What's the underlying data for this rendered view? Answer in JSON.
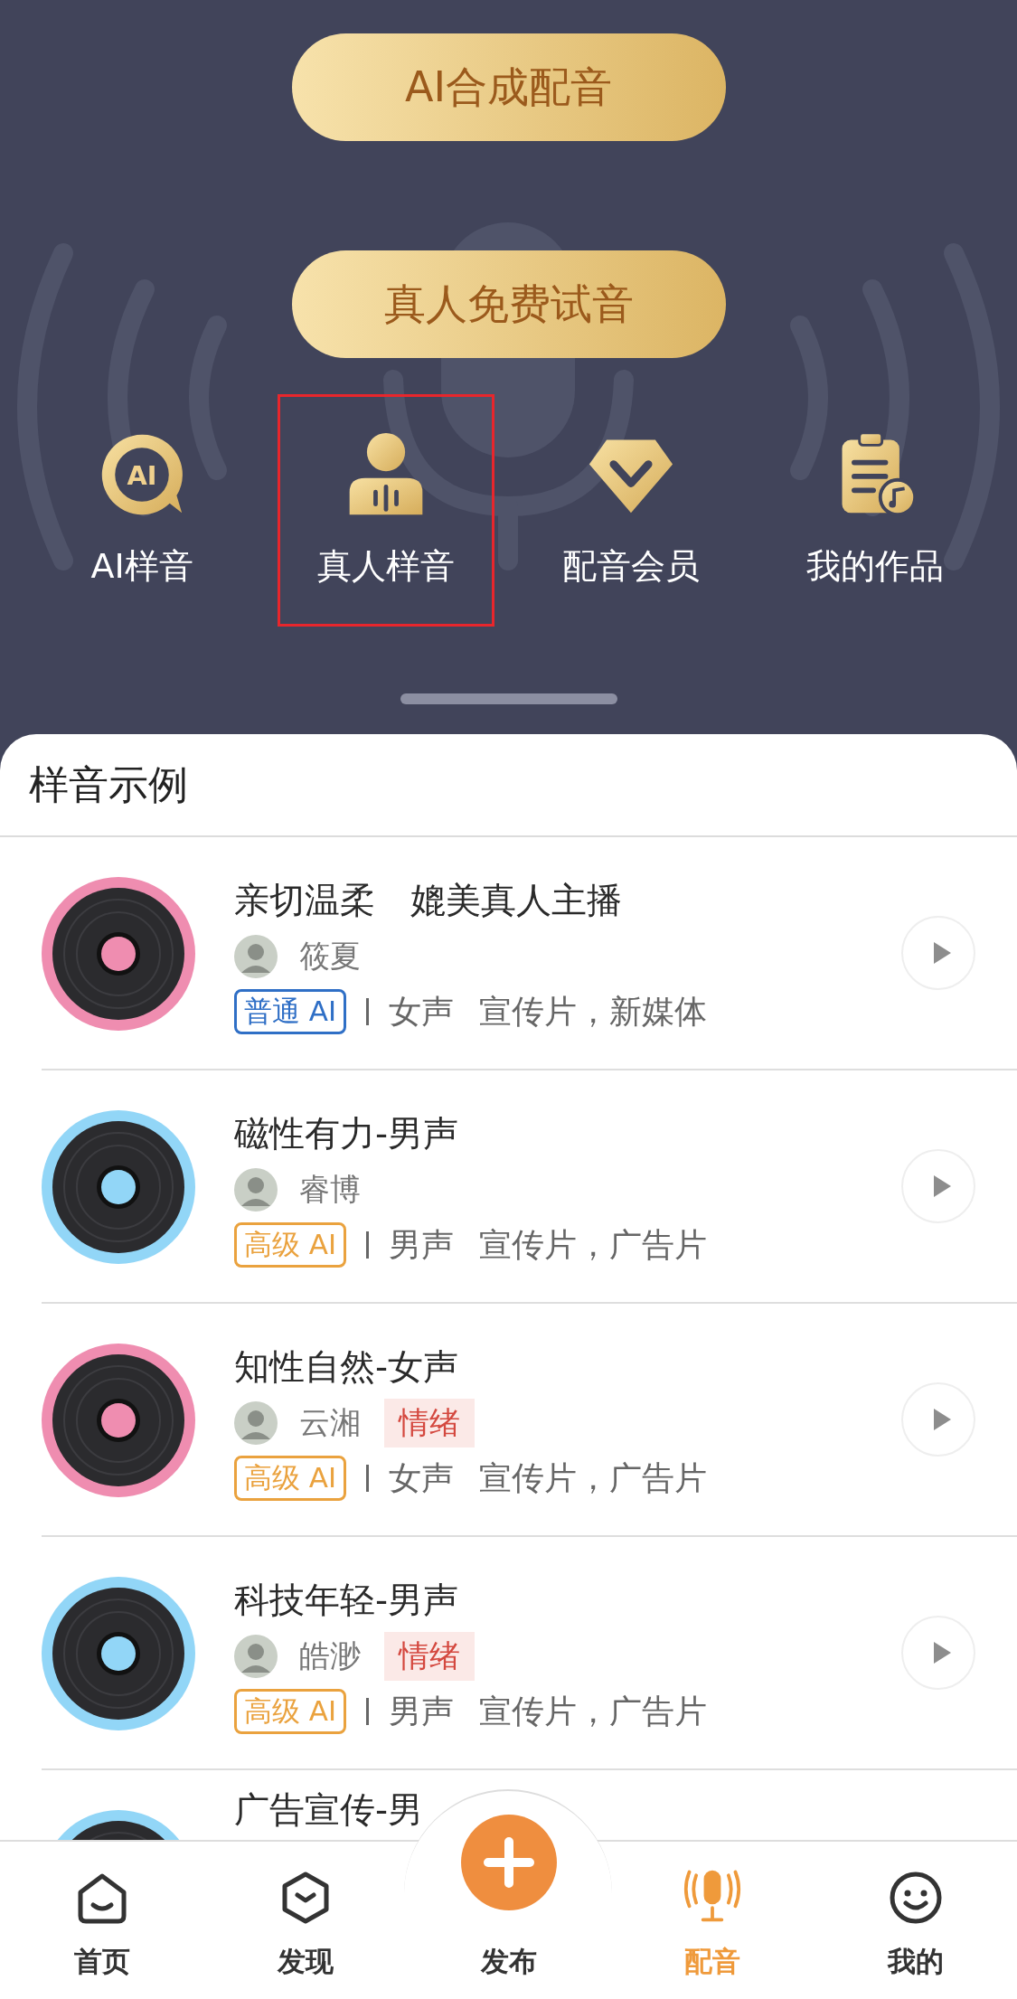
{
  "header": {
    "buttons": [
      "AI合成配音",
      "真人免费试音"
    ],
    "shortcuts": [
      {
        "label": "AI样音",
        "kind": "ai",
        "badge": "AI",
        "selected": false
      },
      {
        "label": "真人样音",
        "kind": "person",
        "selected": true
      },
      {
        "label": "配音会员",
        "kind": "diamond",
        "selected": false
      },
      {
        "label": "我的作品",
        "kind": "works",
        "selected": false
      }
    ]
  },
  "section_title": "样音示例",
  "samples": [
    {
      "title": "亲切温柔　媲美真人主播",
      "author": "筱夏",
      "tier": {
        "label": "普通 AI",
        "kind": "basic"
      },
      "gender": "女声",
      "tags": "宣传片，新媒体",
      "color": "#ef8db0"
    },
    {
      "title": "磁性有力-男声",
      "author": "睿博",
      "tier": {
        "label": "高级 AI",
        "kind": "advanced"
      },
      "gender": "男声",
      "tags": "宣传片，广告片",
      "color": "#92d6f7"
    },
    {
      "title": "知性自然-女声",
      "author": "云湘",
      "emotion": "情绪",
      "tier": {
        "label": "高级 AI",
        "kind": "advanced"
      },
      "gender": "女声",
      "tags": "宣传片，广告片",
      "color": "#ef8db0"
    },
    {
      "title": "科技年轻-男声",
      "author": "皓渺",
      "emotion": "情绪",
      "tier": {
        "label": "高级 AI",
        "kind": "advanced"
      },
      "gender": "男声",
      "tags": "宣传片，广告片",
      "color": "#92d6f7"
    },
    {
      "title": "广告宣传-男",
      "color": "#92d6f7"
    }
  ],
  "bottom_nav": [
    {
      "label": "首页",
      "kind": "home",
      "selected": false
    },
    {
      "label": "发现",
      "kind": "discover",
      "selected": false
    },
    {
      "label": "发布",
      "kind": "add",
      "selected": false
    },
    {
      "label": "配音",
      "kind": "mic",
      "selected": true
    },
    {
      "label": "我的",
      "kind": "me",
      "selected": false
    }
  ]
}
